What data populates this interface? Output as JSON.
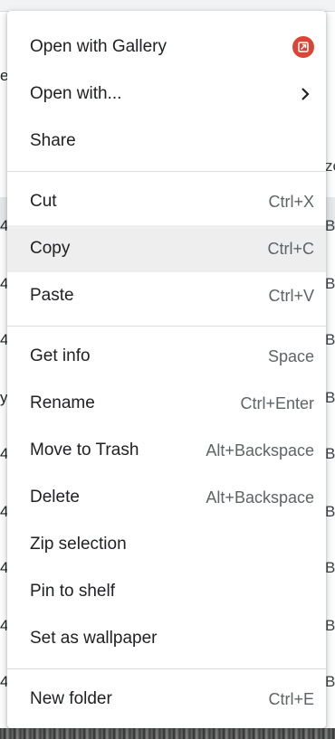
{
  "background": {
    "left_fragments": [
      "e",
      "4-",
      "4-",
      "4-",
      "y",
      "4-",
      "4-",
      "4-",
      "4-",
      "4-"
    ],
    "right_fragments": [
      "ze",
      "B",
      "B",
      "B",
      "B",
      "B",
      "B",
      "B",
      "B",
      "B"
    ]
  },
  "menu": {
    "open_with_gallery": "Open with Gallery",
    "open_with": "Open with...",
    "share": "Share",
    "cut": "Cut",
    "cut_shortcut": "Ctrl+X",
    "copy": "Copy",
    "copy_shortcut": "Ctrl+C",
    "paste": "Paste",
    "paste_shortcut": "Ctrl+V",
    "get_info": "Get info",
    "get_info_shortcut": "Space",
    "rename": "Rename",
    "rename_shortcut": "Ctrl+Enter",
    "move_to_trash": "Move to Trash",
    "move_to_trash_shortcut": "Alt+Backspace",
    "delete": "Delete",
    "delete_shortcut": "Alt+Backspace",
    "zip_selection": "Zip selection",
    "pin_to_shelf": "Pin to shelf",
    "set_as_wallpaper": "Set as wallpaper",
    "new_folder": "New folder",
    "new_folder_shortcut": "Ctrl+E",
    "hovered_item": "Copy",
    "icons": {
      "gallery": "gallery-app-icon",
      "submenu": "chevron-right-icon"
    },
    "accent_color": "#db4437"
  }
}
